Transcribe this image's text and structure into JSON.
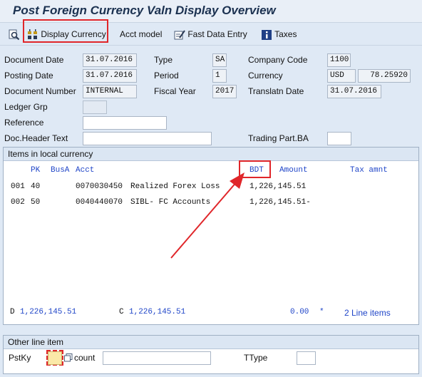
{
  "title": "Post Foreign Currency Valn Display Overview",
  "toolbar": {
    "display_currency": "Display Currency",
    "acct_model": "Acct model",
    "fast_data_entry": "Fast Data Entry",
    "taxes": "Taxes"
  },
  "header": {
    "document_date_label": "Document Date",
    "document_date": "31.07.2016",
    "type_label": "Type",
    "type": "SA",
    "company_code_label": "Company Code",
    "company_code": "1100",
    "posting_date_label": "Posting Date",
    "posting_date": "31.07.2016",
    "period_label": "Period",
    "period": "1",
    "currency_label": "Currency",
    "currency": "USD",
    "exchange_rate": "78.25920",
    "document_number_label": "Document Number",
    "document_number": "INTERNAL",
    "fiscal_year_label": "Fiscal Year",
    "fiscal_year": "2017",
    "translatn_date_label": "Translatn Date",
    "translatn_date": "31.07.2016",
    "ledger_grp_label": "Ledger Grp",
    "ledger_grp": "",
    "reference_label": "Reference",
    "reference": "",
    "doc_header_text_label": "Doc.Header Text",
    "doc_header_text": "",
    "trading_part_label": "Trading Part.BA",
    "trading_part": ""
  },
  "items": {
    "section_title": "Items in local currency",
    "columns": {
      "pk": "PK",
      "busa": "BusA",
      "acct": "Acct",
      "currency": "BDT",
      "amount": "Amount",
      "tax_amnt": "Tax amnt"
    },
    "rows": [
      {
        "no": "001",
        "pk": "40",
        "acct": "0070030450",
        "text": "Realized Forex Loss",
        "amount": "1,226,145.51"
      },
      {
        "no": "002",
        "pk": "50",
        "acct": "0040440070",
        "text": "SIBL- FC Accounts",
        "amount": "1,226,145.51-"
      }
    ],
    "footer": {
      "d_label": "D",
      "d_amount": "1,226,145.51",
      "c_label": "C",
      "c_amount": "1,226,145.51",
      "balance": "0.00",
      "balance_marker": "*",
      "line_items": "2 Line items"
    }
  },
  "other_line_item": {
    "section_title": "Other line item",
    "pstky_label": "PstKy",
    "pstky": "",
    "account_label": "count",
    "account": "",
    "ttype_label": "TType",
    "ttype": ""
  },
  "colors": {
    "annotation_red": "#e0262a",
    "sap_blue_text": "#1f45c8",
    "background": "#dfe9f5"
  }
}
